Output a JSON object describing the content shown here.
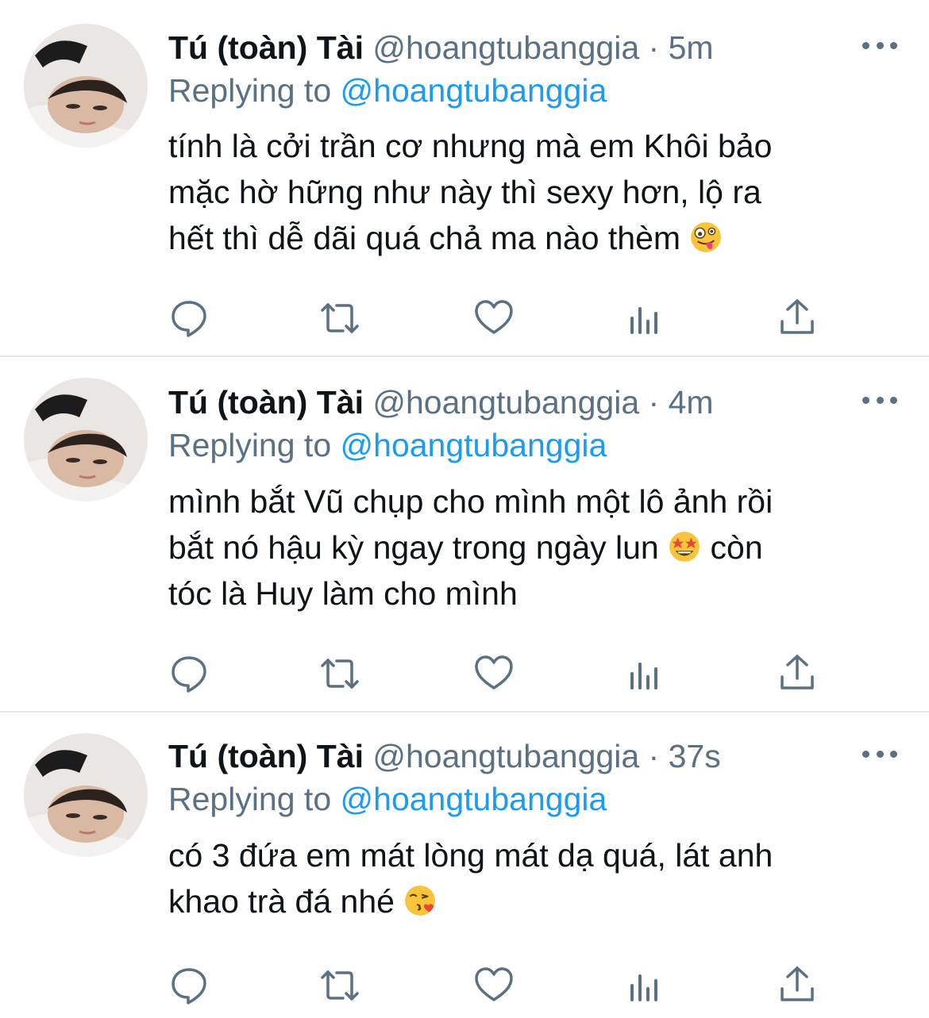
{
  "tweets": [
    {
      "display_name": "Tú (toàn) Tài",
      "handle": "@hoangtubanggia",
      "separator": "·",
      "time": "5m",
      "reply_label": "Replying to",
      "reply_handle": "@hoangtubanggia",
      "lines": [
        "tính là cởi trần cơ nhưng mà em Khôi bảo",
        "mặc hờ hững như này thì sexy hơn, lộ ra",
        "hết thì dễ dãi quá chả ma nào thèm"
      ],
      "emoji": "zany-face-emoji"
    },
    {
      "display_name": "Tú (toàn) Tài",
      "handle": "@hoangtubanggia",
      "separator": "·",
      "time": "4m",
      "reply_label": "Replying to",
      "reply_handle": "@hoangtubanggia",
      "lines": [
        "mình bắt Vũ chụp cho mình một lô ảnh rồi",
        "bắt nó hậu kỳ ngay trong ngày lun",
        "còn",
        "tóc là Huy làm cho mình"
      ],
      "emoji": "star-struck-emoji"
    },
    {
      "display_name": "Tú (toàn) Tài",
      "handle": "@hoangtubanggia",
      "separator": "·",
      "time": "37s",
      "reply_label": "Replying to",
      "reply_handle": "@hoangtubanggia",
      "lines": [
        "có 3 đứa em mát lòng mát dạ quá, lát anh",
        "khao trà đá nhé"
      ],
      "emoji": "kissing-heart-emoji"
    }
  ],
  "action_icons": [
    "reply-icon",
    "retweet-icon",
    "like-icon",
    "analytics-icon",
    "share-icon"
  ],
  "colors": {
    "text": "#0f1419",
    "secondary": "#5b7083",
    "link": "#1d9bf0",
    "divider": "#e1e8ed"
  }
}
